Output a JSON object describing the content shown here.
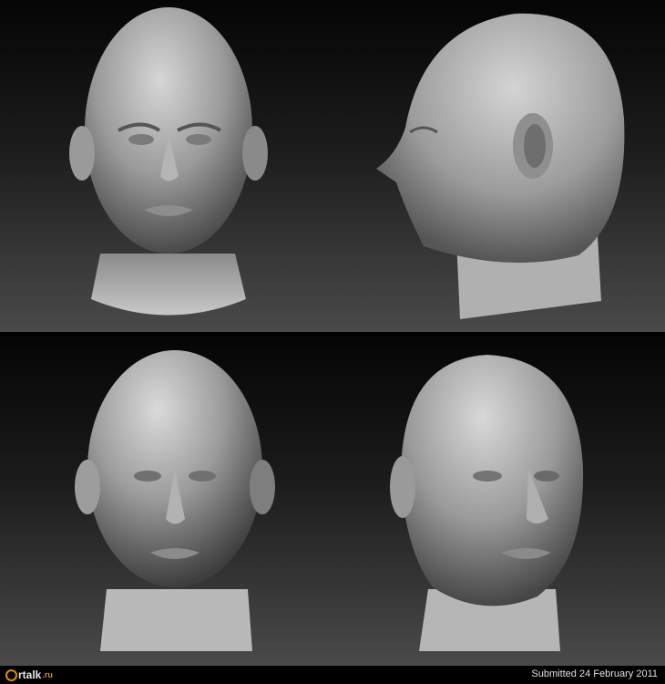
{
  "renders": [
    {
      "view": "front"
    },
    {
      "view": "right profile"
    },
    {
      "view": "front, three-quarter lighting"
    },
    {
      "view": "three-quarter left"
    }
  ],
  "footer": {
    "logo_text": "rtalk",
    "logo_domain": ".ru",
    "submitted": "Submitted 24 February 2011"
  },
  "colors": {
    "accent": "#e08a1a",
    "skin_light": "#cfcfcf",
    "skin_dark": "#3c3c3c"
  }
}
